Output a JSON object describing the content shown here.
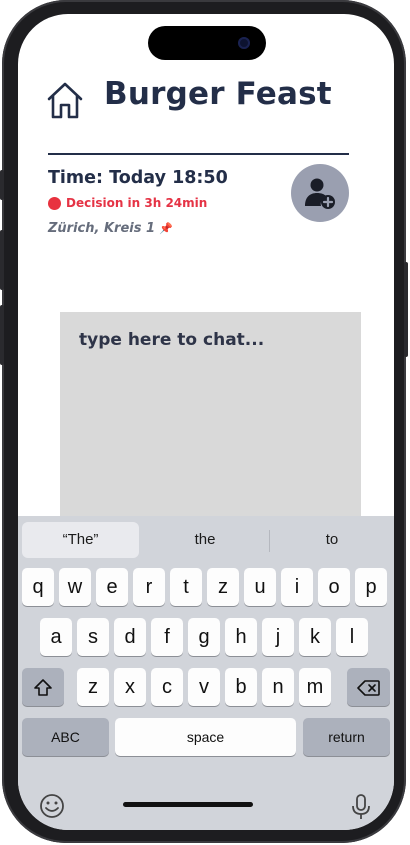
{
  "header": {
    "home_icon": "home-icon",
    "title": "Burger Feast"
  },
  "event": {
    "time": "Time: Today 18:50",
    "decision": "Decision in 3h 24min",
    "location": "Zürich, Kreis 1",
    "pin_icon": "📌",
    "add_user_icon": "add-user-icon"
  },
  "chat": {
    "placeholder": "type here to chat..."
  },
  "keyboard": {
    "suggestions": [
      "“The”",
      "the",
      "to"
    ],
    "row1": [
      "q",
      "w",
      "e",
      "r",
      "t",
      "z",
      "u",
      "i",
      "o",
      "p"
    ],
    "row2": [
      "a",
      "s",
      "d",
      "f",
      "g",
      "h",
      "j",
      "k",
      "l"
    ],
    "row3": [
      "z",
      "x",
      "c",
      "v",
      "b",
      "n",
      "m"
    ],
    "abc": "ABC",
    "space": "space",
    "return": "return"
  },
  "colors": {
    "primary_text": "#232e48",
    "alert": "#e53345",
    "avatar_bg": "#9a9fb0",
    "chat_bg": "#d9d9d9",
    "keyboard_bg": "#d1d4da"
  }
}
